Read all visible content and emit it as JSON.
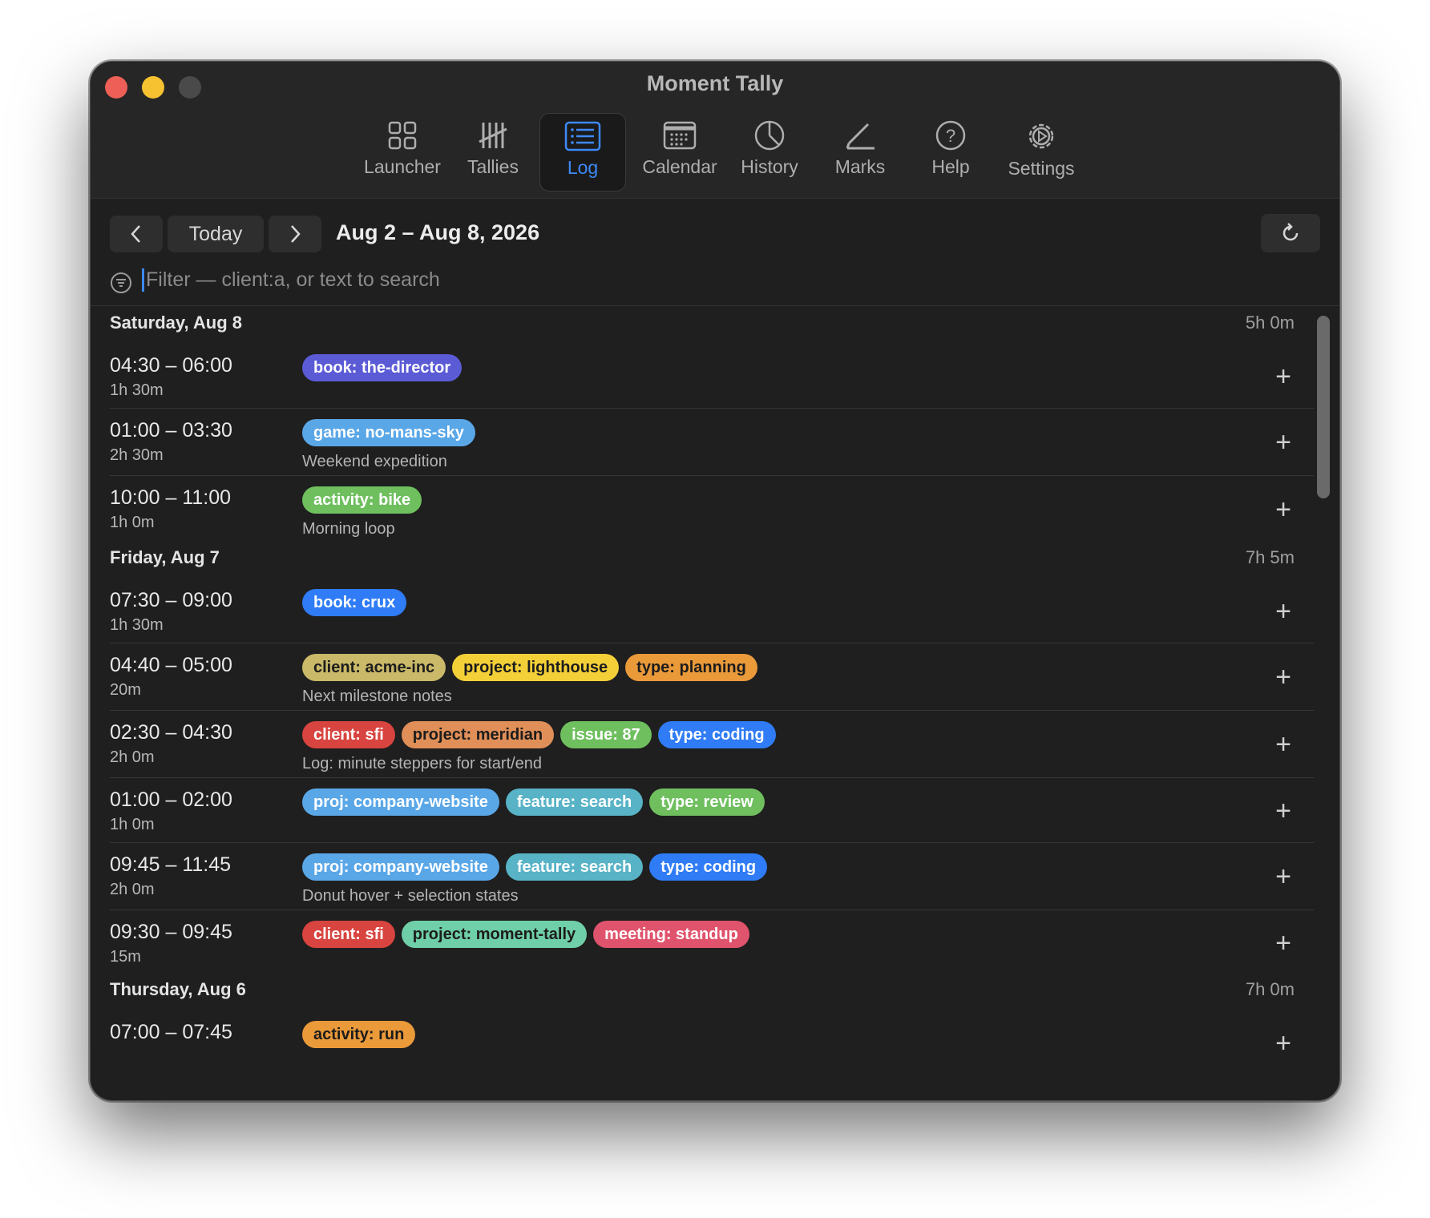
{
  "window": {
    "title": "Moment Tally"
  },
  "toolbar": {
    "items": [
      {
        "label": "Launcher",
        "icon": "grid-icon",
        "active": false
      },
      {
        "label": "Tallies",
        "icon": "tally-icon",
        "active": false
      },
      {
        "label": "Log",
        "icon": "list-icon",
        "active": true
      },
      {
        "label": "Calendar",
        "icon": "calendar-icon",
        "active": false
      },
      {
        "label": "History",
        "icon": "pie-chart-icon",
        "active": false
      },
      {
        "label": "Marks",
        "icon": "pencil-icon",
        "active": false
      },
      {
        "label": "Help",
        "icon": "question-icon",
        "active": false
      },
      {
        "label": "Settings",
        "icon": "gear-icon",
        "active": false
      }
    ]
  },
  "nav": {
    "prev_label": "‹",
    "today_label": "Today",
    "next_label": "›",
    "range": "Aug 2 – Aug 8, 2026",
    "refresh_icon": "refresh-icon"
  },
  "filter": {
    "placeholder": "Filter — client:a, or text to search"
  },
  "colors": {
    "accent": "#3d8af7",
    "indigo": "#5b5bd6",
    "sky": "#5aa7e8",
    "green": "#6fbf5f",
    "blue": "#2f7cf6",
    "khaki": "#c9b968",
    "yellow": "#f4d038",
    "orange": "#eb9a3a",
    "red": "#d8443f",
    "salmon": "#e08f58",
    "teal": "#58b3c6",
    "mint": "#6fcfa8",
    "pink": "#e0536c"
  },
  "days": [
    {
      "label": "Saturday, Aug 8",
      "total": "5h 0m",
      "entries": [
        {
          "time": "04:30 – 06:00",
          "duration": "1h 30m",
          "note": "",
          "tags": [
            {
              "text": "book: the-director",
              "bg": "#5b5bd6",
              "fg": "#ffffff"
            }
          ]
        },
        {
          "time": "01:00 – 03:30",
          "duration": "2h 30m",
          "note": "Weekend expedition",
          "tags": [
            {
              "text": "game: no-mans-sky",
              "bg": "#5aa7e8",
              "fg": "#ffffff"
            }
          ]
        },
        {
          "time": "10:00 – 11:00",
          "duration": "1h 0m",
          "note": "Morning loop",
          "tags": [
            {
              "text": "activity: bike",
              "bg": "#6fbf5f",
              "fg": "#ffffff"
            }
          ]
        }
      ]
    },
    {
      "label": "Friday, Aug 7",
      "total": "7h 5m",
      "entries": [
        {
          "time": "07:30 – 09:00",
          "duration": "1h 30m",
          "note": "",
          "tags": [
            {
              "text": "book: crux",
              "bg": "#2f7cf6",
              "fg": "#ffffff"
            }
          ]
        },
        {
          "time": "04:40 – 05:00",
          "duration": "20m",
          "note": "Next milestone notes",
          "tags": [
            {
              "text": "client: acme-inc",
              "bg": "#c9b968",
              "fg": "#1c1c1c"
            },
            {
              "text": "project: lighthouse",
              "bg": "#f4d038",
              "fg": "#1c1c1c"
            },
            {
              "text": "type: planning",
              "bg": "#eb9a3a",
              "fg": "#1c1c1c"
            }
          ]
        },
        {
          "time": "02:30 – 04:30",
          "duration": "2h 0m",
          "note": "Log: minute steppers for start/end",
          "tags": [
            {
              "text": "client: sfi",
              "bg": "#d8443f",
              "fg": "#ffffff"
            },
            {
              "text": "project: meridian",
              "bg": "#e08f58",
              "fg": "#1c1c1c"
            },
            {
              "text": "issue: 87",
              "bg": "#6fbf5f",
              "fg": "#ffffff"
            },
            {
              "text": "type: coding",
              "bg": "#2f7cf6",
              "fg": "#ffffff"
            }
          ]
        },
        {
          "time": "01:00 – 02:00",
          "duration": "1h 0m",
          "note": "",
          "tags": [
            {
              "text": "proj: company-website",
              "bg": "#5aa7e8",
              "fg": "#ffffff"
            },
            {
              "text": "feature: search",
              "bg": "#58b3c6",
              "fg": "#ffffff"
            },
            {
              "text": "type: review",
              "bg": "#6fbf5f",
              "fg": "#ffffff"
            }
          ]
        },
        {
          "time": "09:45 – 11:45",
          "duration": "2h 0m",
          "note": "Donut hover + selection states",
          "tags": [
            {
              "text": "proj: company-website",
              "bg": "#5aa7e8",
              "fg": "#ffffff"
            },
            {
              "text": "feature: search",
              "bg": "#58b3c6",
              "fg": "#ffffff"
            },
            {
              "text": "type: coding",
              "bg": "#2f7cf6",
              "fg": "#ffffff"
            }
          ]
        },
        {
          "time": "09:30 – 09:45",
          "duration": "15m",
          "note": "",
          "tags": [
            {
              "text": "client: sfi",
              "bg": "#d8443f",
              "fg": "#ffffff"
            },
            {
              "text": "project: moment-tally",
              "bg": "#6fcfa8",
              "fg": "#1c1c1c"
            },
            {
              "text": "meeting: standup",
              "bg": "#e0536c",
              "fg": "#ffffff"
            }
          ]
        }
      ]
    },
    {
      "label": "Thursday, Aug 6",
      "total": "7h 0m",
      "entries": [
        {
          "time": "07:00 – 07:45",
          "duration": "",
          "note": "",
          "tags": [
            {
              "text": "activity: run",
              "bg": "#eb9a3a",
              "fg": "#1c1c1c"
            }
          ]
        }
      ]
    }
  ]
}
